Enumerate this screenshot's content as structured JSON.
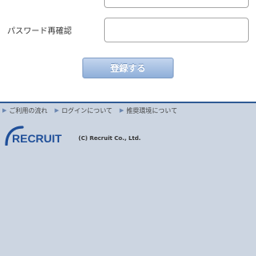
{
  "form": {
    "password_confirm_label": "パスワード再確認",
    "password_value": "",
    "password_confirm_value": "",
    "register_button": "登録する"
  },
  "footer": {
    "links": [
      {
        "label": "ご利用の流れ",
        "icon": "triangle-right-icon"
      },
      {
        "label": "ログインについて",
        "icon": "triangle-right-icon"
      },
      {
        "label": "推奨環境について",
        "icon": "triangle-right-icon"
      }
    ],
    "logo_text": "RECRUIT",
    "copyright": "(C) Recruit Co., Ltd."
  },
  "colors": {
    "accent": "#2f5a94",
    "footer_bg": "#ccd5e1",
    "button_top": "#c3d5ee",
    "button_bottom": "#8fafd9"
  }
}
